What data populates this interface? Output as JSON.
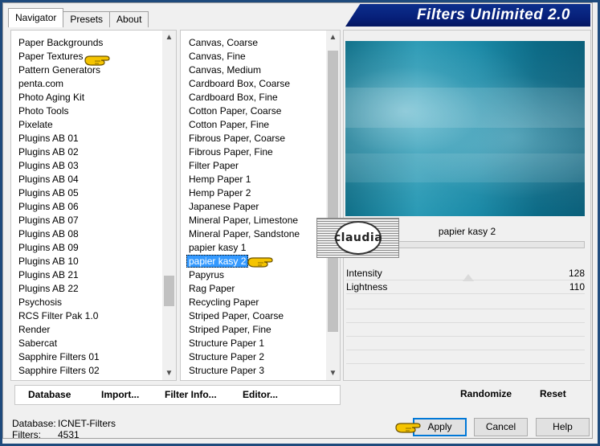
{
  "window": {
    "title": "Filters Unlimited 2.0"
  },
  "tabs": [
    {
      "label": "Navigator",
      "active": true
    },
    {
      "label": "Presets",
      "active": false
    },
    {
      "label": "About",
      "active": false
    }
  ],
  "categories": {
    "items": [
      "Paper Backgrounds",
      "Paper Textures",
      "Pattern Generators",
      "penta.com",
      "Photo Aging Kit",
      "Photo Tools",
      "Pixelate",
      "Plugins AB 01",
      "Plugins AB 02",
      "Plugins AB 03",
      "Plugins AB 04",
      "Plugins AB 05",
      "Plugins AB 06",
      "Plugins AB 07",
      "Plugins AB 08",
      "Plugins AB 09",
      "Plugins AB 10",
      "Plugins AB 21",
      "Plugins AB 22",
      "Psychosis",
      "RCS Filter Pak 1.0",
      "Render",
      "Sabercat",
      "Sapphire Filters 01",
      "Sapphire Filters 02"
    ],
    "pointed_index": 1
  },
  "filters": {
    "items": [
      "Canvas, Coarse",
      "Canvas, Fine",
      "Canvas, Medium",
      "Cardboard Box, Coarse",
      "Cardboard Box, Fine",
      "Cotton Paper, Coarse",
      "Cotton Paper, Fine",
      "Fibrous Paper, Coarse",
      "Fibrous Paper, Fine",
      "Filter Paper",
      "Hemp Paper 1",
      "Hemp Paper 2",
      "Japanese Paper",
      "Mineral Paper, Limestone",
      "Mineral Paper, Sandstone",
      "papier kasy 1",
      "papier kasy 2",
      "Papyrus",
      "Rag Paper",
      "Recycling Paper",
      "Striped Paper, Coarse",
      "Striped Paper, Fine",
      "Structure Paper 1",
      "Structure Paper 2",
      "Structure Paper 3"
    ],
    "selected_index": 16
  },
  "preview": {
    "filter_name": "papier kasy 2",
    "params": [
      {
        "label": "Intensity",
        "value": "128"
      },
      {
        "label": "Lightness",
        "value": "110"
      }
    ]
  },
  "toolbar": {
    "database": "Database",
    "import": "Import...",
    "filter_info": "Filter Info...",
    "editor": "Editor...",
    "randomize": "Randomize",
    "reset": "Reset"
  },
  "status": {
    "database_label": "Database:",
    "database_value": "ICNET-Filters",
    "filters_label": "Filters:",
    "filters_value": "4531"
  },
  "buttons": {
    "apply": "Apply",
    "cancel": "Cancel",
    "help": "Help"
  },
  "watermark": {
    "text": "claudia"
  },
  "colors": {
    "selection": "#3399ff",
    "banner": "#0a2a84",
    "hand": "#f5c400"
  }
}
